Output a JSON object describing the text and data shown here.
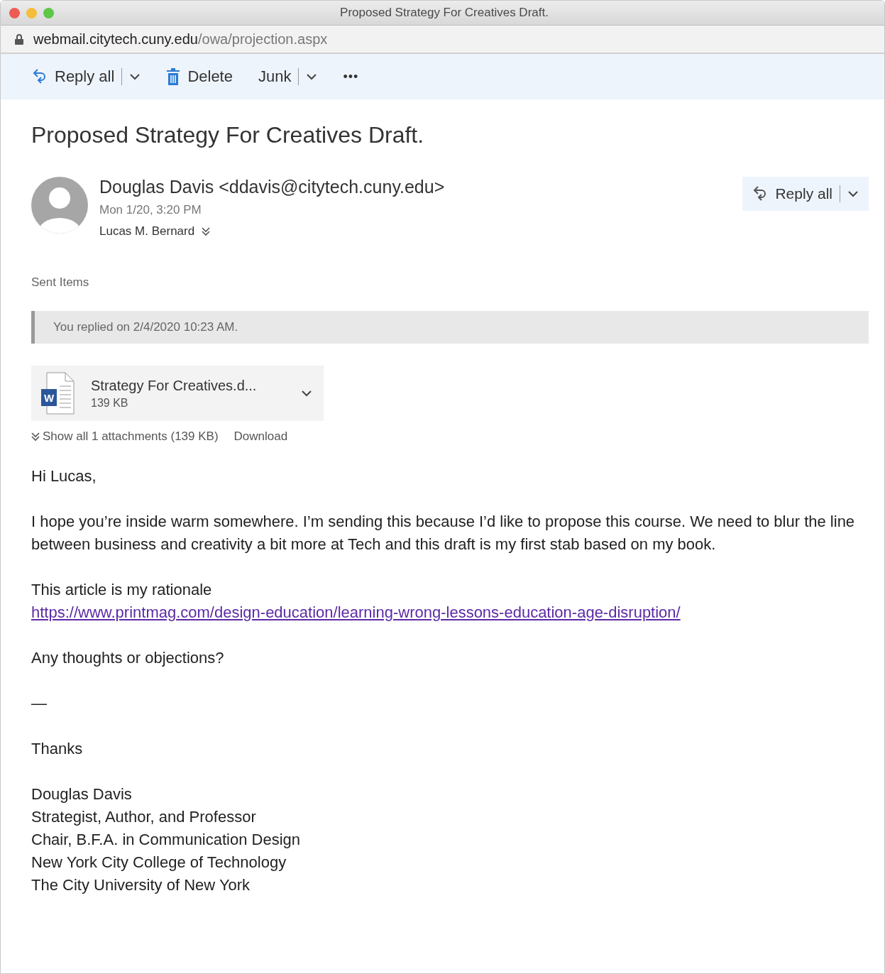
{
  "window": {
    "title": "Proposed Strategy For Creatives Draft.",
    "url_host": "webmail.citytech.cuny.edu",
    "url_path": "/owa/projection.aspx"
  },
  "toolbar": [
    {
      "kind": "reply",
      "label": "Reply all"
    },
    {
      "kind": "delete",
      "label": "Delete"
    },
    {
      "kind": "split",
      "label": "Junk"
    },
    {
      "kind": "more",
      "label": "•••"
    }
  ],
  "message": {
    "subject": "Proposed Strategy For Creatives Draft.",
    "sender": "Douglas Davis <ddavis@citytech.cuny.edu>",
    "date": "Mon 1/20, 3:20 PM",
    "recipient": "Lucas M. Bernard",
    "reply_button": "Reply all",
    "folder": "Sent Items",
    "notice": "You replied on 2/4/2020 10:23 AM."
  },
  "attachment": {
    "icon_letter": "W",
    "name": "Strategy For Creatives.d...",
    "size": "139 KB",
    "show_all": "Show all 1 attachments (139 KB)",
    "download": "Download"
  },
  "body": [
    {
      "kind": "text",
      "lines": [
        {
          "kind": "text",
          "text": "Hi Lucas,"
        }
      ]
    },
    {
      "kind": "text",
      "lines": [
        {
          "kind": "text",
          "text": "I hope you’re inside warm somewhere. I’m sending this because I’d like to propose this course. We need to blur the line between business and creativity a bit more at Tech and this draft is my first stab based on my book."
        }
      ]
    },
    {
      "kind": "text",
      "lines": [
        {
          "kind": "text",
          "text": "This article is my rationale"
        },
        {
          "kind": "link",
          "text": "https://www.printmag.com/design-education/learning-wrong-lessons-education-age-disruption/"
        }
      ]
    },
    {
      "kind": "text",
      "lines": [
        {
          "kind": "text",
          "text": "Any thoughts or objections?"
        }
      ]
    },
    {
      "kind": "text",
      "lines": [
        {
          "kind": "text",
          "text": "—"
        }
      ]
    },
    {
      "kind": "text",
      "lines": [
        {
          "kind": "text",
          "text": "Thanks"
        }
      ]
    },
    {
      "kind": "signature",
      "lines": [
        {
          "kind": "text",
          "text": "Douglas Davis"
        },
        {
          "kind": "text",
          "text": "Strategist, Author, and Professor"
        },
        {
          "kind": "text",
          "text": "Chair, B.F.A. in Communication Design"
        },
        {
          "kind": "text",
          "text": "New York City College of Technology"
        },
        {
          "kind": "text",
          "text": "The City University of New York"
        }
      ]
    }
  ]
}
